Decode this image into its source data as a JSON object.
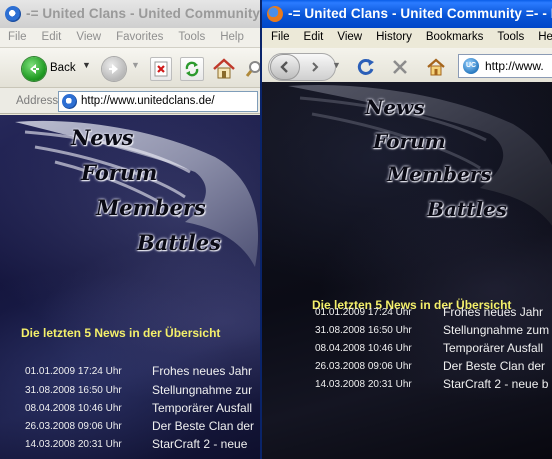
{
  "ie": {
    "title": "-= United Clans - United Community",
    "menu": [
      "File",
      "Edit",
      "View",
      "Favorites",
      "Tools",
      "Help"
    ],
    "back_label": "Back",
    "address_label": "Address",
    "url": "http://www.unitedclans.de/"
  },
  "firefox": {
    "title": "-= United Clans - United Community =- - M",
    "menu": [
      "File",
      "Edit",
      "View",
      "History",
      "Bookmarks",
      "Tools",
      "Help"
    ],
    "url": "http://www.",
    "site_badge": "UC"
  },
  "site": {
    "nav": [
      "News",
      "Forum",
      "Members",
      "Battles"
    ],
    "news_heading": "Die letzten 5 News in der Übersicht",
    "news": [
      {
        "date": "01.01.2009 17:24 Uhr",
        "title_ie": "Frohes neues Jahr",
        "title_ff": "Frohes neues Jahr"
      },
      {
        "date": "31.08.2008 16:50 Uhr",
        "title_ie": "Stellungnahme zur",
        "title_ff": "Stellungnahme zum"
      },
      {
        "date": "08.04.2008 10:46 Uhr",
        "title_ie": "Temporärer Ausfall",
        "title_ff": "Temporärer Ausfall"
      },
      {
        "date": "26.03.2008 09:06 Uhr",
        "title_ie": "Der Beste Clan der",
        "title_ff": "Der Beste Clan der"
      },
      {
        "date": "14.03.2008 20:31 Uhr",
        "title_ie": "StarCraft 2 - neue",
        "title_ff": "StarCraft 2 - neue b"
      }
    ]
  },
  "colors": {
    "news_heading": "#f4f06a",
    "news_text": "#f0f0f0",
    "ff_titlebar": "#0854d6",
    "ie_titlebar_inactive": "#cfcfcf"
  },
  "icons": [
    "ie-logo-icon",
    "firefox-logo-icon",
    "back-arrow-icon",
    "forward-arrow-icon",
    "stop-icon",
    "refresh-icon",
    "home-icon",
    "search-icon",
    "page-icon",
    "site-favicon-icon",
    "wing-logo-icon"
  ]
}
